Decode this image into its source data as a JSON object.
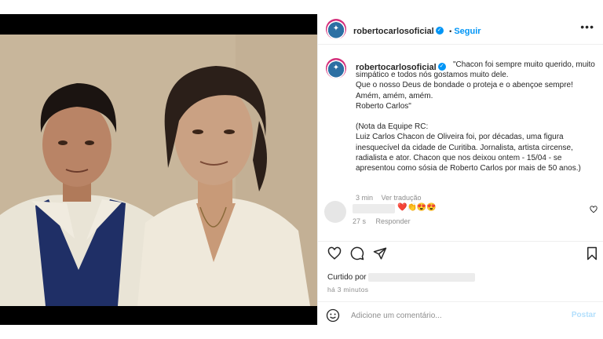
{
  "post": {
    "username": "robertocarlosoficial",
    "verified_mark": "✓",
    "separator": "•",
    "follow_label": "Seguir",
    "more_label": "•••",
    "caption": "\"Chacon foi sempre muito querido, muito simpático e todos nós gostamos muito dele.\nQue o nosso Deus de bondade o proteja e o abençoe sempre!\nAmém, amém, amém.\nRoberto Carlos\"\n\n(Nota da Equipe RC:\nLuiz Carlos Chacon de Oliveira foi, por décadas, uma figura inesquecível da cidade de Curitiba. Jornalista, artista circense, radialista e ator. Chacon que nos deixou ontem - 15/04 - se apresentou como sósia de Roberto Carlos por mais de 50 anos.)",
    "caption_time": "3 min",
    "translate_label": "Ver tradução"
  },
  "comment": {
    "emojis": "❤️👏😍😍",
    "time": "27 s",
    "reply_label": "Responder"
  },
  "likes": {
    "label": "Curtido por",
    "time": "há 3 minutos"
  },
  "add_comment": {
    "placeholder": "Adicione um comentário...",
    "post_label": "Postar"
  },
  "colors": {
    "accent": "#0095f6",
    "post_disabled": "#b2dffc",
    "meta": "#8e8e8e",
    "photo_background": "#c6b398"
  },
  "icons": [
    "heart-icon",
    "comment-icon",
    "share-icon",
    "save-icon",
    "emoji-icon",
    "more-icon",
    "verified-icon"
  ]
}
